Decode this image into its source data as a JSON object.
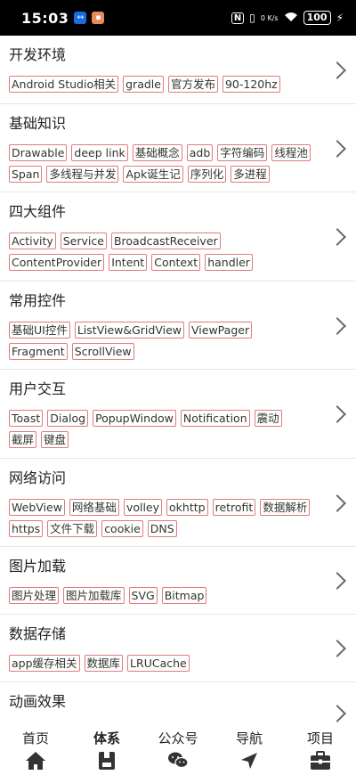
{
  "status_bar": {
    "time": "15:03",
    "right_icons": [
      "nfc-icon",
      "vibrate-icon",
      "network-speed-icon",
      "wifi-icon"
    ],
    "network_speed": "0 K/s",
    "battery": "100"
  },
  "categories": [
    {
      "title": "开发环境",
      "tags": [
        "Android Studio相关",
        "gradle",
        "官方发布",
        "90-120hz"
      ]
    },
    {
      "title": "基础知识",
      "tags": [
        "Drawable",
        "deep link",
        "基础概念",
        "adb",
        "字符编码",
        "线程池",
        "Span",
        "多线程与并发",
        "Apk诞生记",
        "序列化",
        "多进程"
      ]
    },
    {
      "title": "四大组件",
      "tags": [
        "Activity",
        "Service",
        "BroadcastReceiver",
        "ContentProvider",
        "Intent",
        "Context",
        "handler"
      ]
    },
    {
      "title": "常用控件",
      "tags": [
        "基础UI控件",
        "ListView&GridView",
        "ViewPager",
        "Fragment",
        "ScrollView"
      ]
    },
    {
      "title": "用户交互",
      "tags": [
        "Toast",
        "Dialog",
        "PopupWindow",
        "Notification",
        "震动",
        "截屏",
        "键盘"
      ]
    },
    {
      "title": "网络访问",
      "tags": [
        "WebView",
        "网络基础",
        "volley",
        "okhttp",
        "retrofit",
        "数据解析",
        "https",
        "文件下载",
        "cookie",
        "DNS"
      ]
    },
    {
      "title": "图片加载",
      "tags": [
        "图片处理",
        "图片加载库",
        "SVG",
        "Bitmap"
      ]
    },
    {
      "title": "数据存储",
      "tags": [
        "app缓存相关",
        "数据库",
        "LRUCache"
      ]
    },
    {
      "title": "动画效果",
      "tags": []
    }
  ],
  "bottom_nav": [
    {
      "label": "首页",
      "icon": "home-icon",
      "active": false
    },
    {
      "label": "体系",
      "icon": "book-icon",
      "active": true
    },
    {
      "label": "公众号",
      "icon": "wechat-icon",
      "active": false
    },
    {
      "label": "导航",
      "icon": "navigation-arrow-icon",
      "active": false
    },
    {
      "label": "项目",
      "icon": "briefcase-icon",
      "active": false
    }
  ],
  "colors": {
    "tag_border": "#e07b7b",
    "nav_icon": "#333333",
    "status_bar_bg": "#000000"
  }
}
